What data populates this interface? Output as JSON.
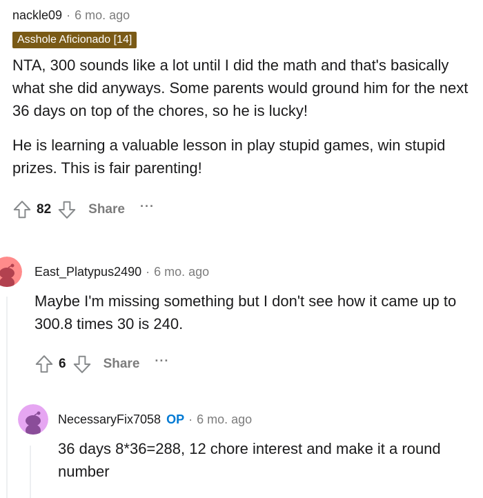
{
  "comments": [
    {
      "author": "nackle09",
      "separator": "·",
      "time": "6 mo. ago",
      "flair": "Asshole Aficionado [14]",
      "paragraphs": [
        "NTA, 300 sounds like a lot until I did the math and that's basically what she did anyways. Some parents would ground him for the next 36 days on top of the chores, so he is lucky!",
        "He is learning a valuable lesson in play stupid games, win stupid prizes. This is fair parenting!"
      ],
      "votes": "82",
      "share_label": "Share",
      "more_label": "···"
    },
    {
      "author": "East_Platypus2490",
      "separator": "·",
      "time": "6 mo. ago",
      "paragraphs": [
        "Maybe I'm missing something but I don't see how it came up to 300.8 times 30 is 240."
      ],
      "votes": "6",
      "share_label": "Share",
      "more_label": "···",
      "avatar_color": "#ff8b8b"
    },
    {
      "author": "NecessaryFix7058",
      "op_label": "OP",
      "separator": "·",
      "time": "6 mo. ago",
      "paragraphs": [
        "36 days 8*36=288, 12 chore interest and make it a round number"
      ],
      "avatar_color": "#e6a6f2"
    }
  ]
}
